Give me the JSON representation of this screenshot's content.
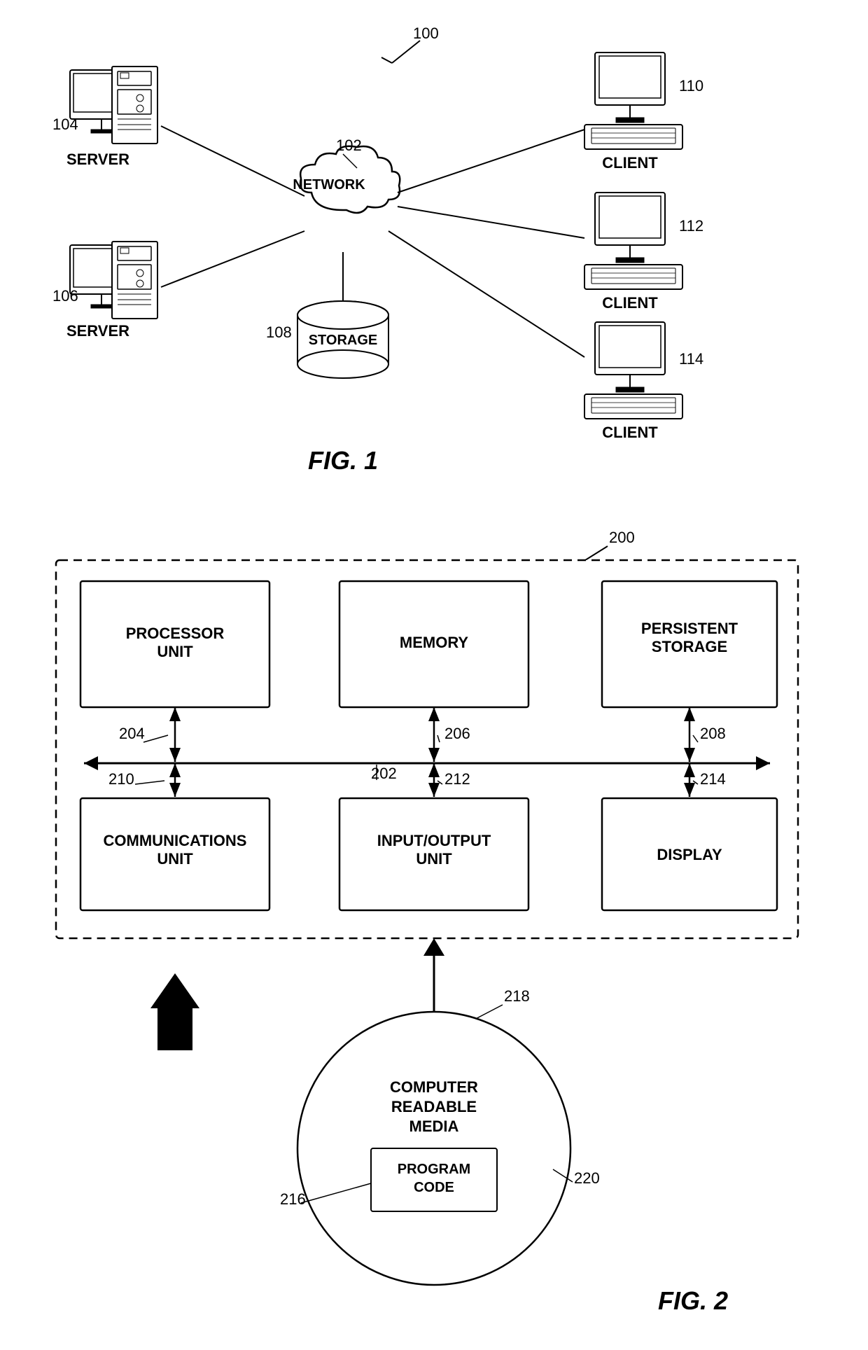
{
  "fig1": {
    "title": "FIG. 1",
    "ref_100": "100",
    "ref_102": "102",
    "ref_104": "104",
    "ref_106": "106",
    "ref_108": "108",
    "ref_110": "110",
    "ref_111": "112",
    "ref_114": "114",
    "network_label": "NETWORK",
    "storage_label": "STORAGE",
    "server1_label": "SERVER",
    "server2_label": "SERVER",
    "client1_label": "CLIENT",
    "client2_label": "CLIENT",
    "client3_label": "CLIENT"
  },
  "fig2": {
    "title": "FIG. 2",
    "ref_200": "200",
    "ref_202": "202",
    "ref_204": "204",
    "ref_206": "206",
    "ref_208": "208",
    "ref_210": "210",
    "ref_212": "212",
    "ref_214": "214",
    "ref_216": "216",
    "ref_218": "218",
    "ref_220": "220",
    "processor_label": "PROCESSOR UNIT",
    "memory_label": "MEMORY",
    "persistent_label": "PERSISTENT\nSTORAGE",
    "communications_label": "COMMUNICATIONS\nUNIT",
    "io_label": "INPUT/OUTPUT\nUNIT",
    "display_label": "DISPLAY",
    "crm_label": "COMPUTER\nREADABLE\nMEDIA",
    "program_label": "PROGRAM\nCODE"
  }
}
